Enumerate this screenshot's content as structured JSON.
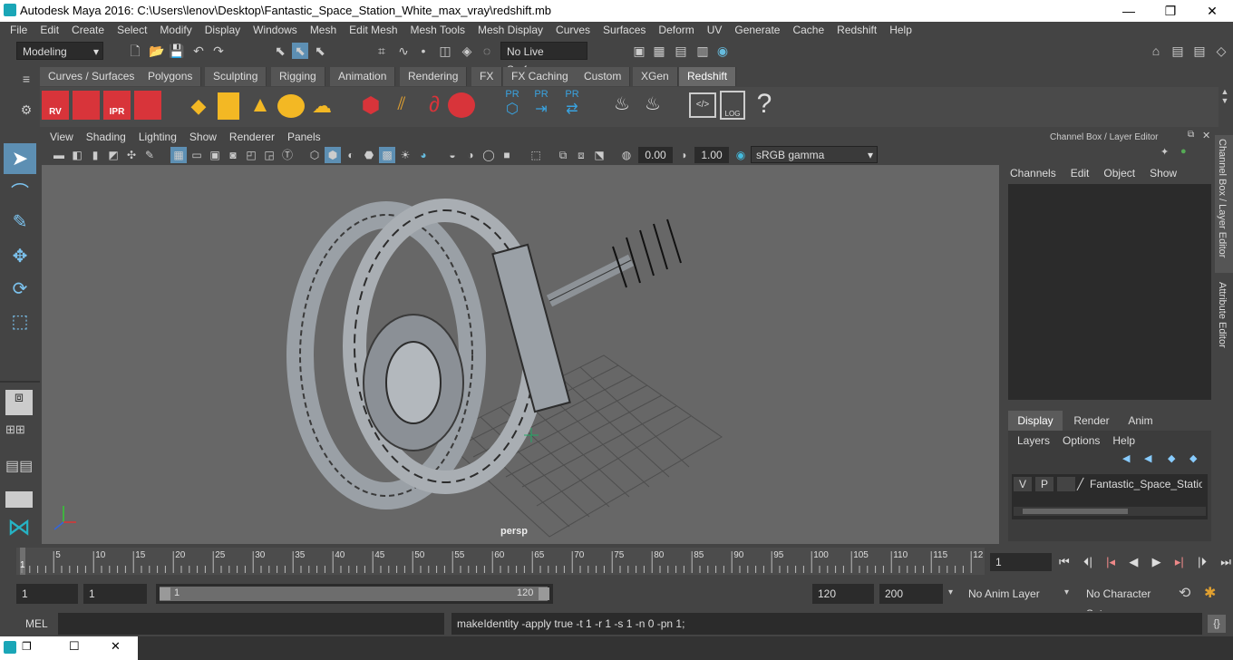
{
  "window": {
    "title": "Autodesk Maya 2016: C:\\Users\\lenov\\Desktop\\Fantastic_Space_Station_White_max_vray\\redshift.mb"
  },
  "menubar": [
    "File",
    "Edit",
    "Create",
    "Select",
    "Modify",
    "Display",
    "Windows",
    "Mesh",
    "Edit Mesh",
    "Mesh Tools",
    "Mesh Display",
    "Curves",
    "Surfaces",
    "Deform",
    "UV",
    "Generate",
    "Cache",
    "Redshift",
    "Help"
  ],
  "statusline": {
    "mode": "Modeling",
    "live_surface": "No Live Surface"
  },
  "shelf_tabs": [
    "Curves / Surfaces",
    "Polygons",
    "Sculpting",
    "Rigging",
    "Animation",
    "Rendering",
    "FX",
    "FX Caching",
    "Custom",
    "XGen",
    "Redshift"
  ],
  "shelf_active": "Redshift",
  "shelf_icons": {
    "rv": "RV",
    "ipr": "IPR",
    "pr1": "PR",
    "pr2": "PR",
    "pr3": "PR",
    "log": "LOG",
    "help": "?"
  },
  "viewport": {
    "menus": [
      "View",
      "Shading",
      "Lighting",
      "Show",
      "Renderer",
      "Panels"
    ],
    "exposure": "0.00",
    "gamma": "1.00",
    "colorspace": "sRGB gamma",
    "camera": "persp"
  },
  "channel_box": {
    "title": "Channel Box / Layer Editor",
    "menus": [
      "Channels",
      "Edit",
      "Object",
      "Show"
    ]
  },
  "layer_editor": {
    "tabs": [
      "Display",
      "Render",
      "Anim"
    ],
    "active_tab": "Display",
    "menus": [
      "Layers",
      "Options",
      "Help"
    ],
    "layer": {
      "v": "V",
      "p": "P",
      "name": "Fantastic_Space_Station_"
    }
  },
  "side_tabs": [
    "Channel Box / Layer Editor",
    "Attribute Editor"
  ],
  "timeline": {
    "ticks": [
      "5",
      "10",
      "15",
      "20",
      "25",
      "30",
      "35",
      "40",
      "45",
      "50",
      "55",
      "60",
      "65",
      "70",
      "75",
      "80",
      "85",
      "90",
      "95",
      "100",
      "105",
      "110",
      "115",
      "12"
    ],
    "start": "1",
    "current_frame": "1"
  },
  "range": {
    "start": "1",
    "playback_start": "1",
    "slider_start": "1",
    "slider_end": "120",
    "playback_end": "120",
    "end": "200",
    "anim_layer": "No Anim Layer",
    "char_set": "No Character Set"
  },
  "mel": {
    "label": "MEL",
    "result": "makeIdentity -apply true -t 1 -r 1 -s 1 -n 0 -pn 1;"
  }
}
